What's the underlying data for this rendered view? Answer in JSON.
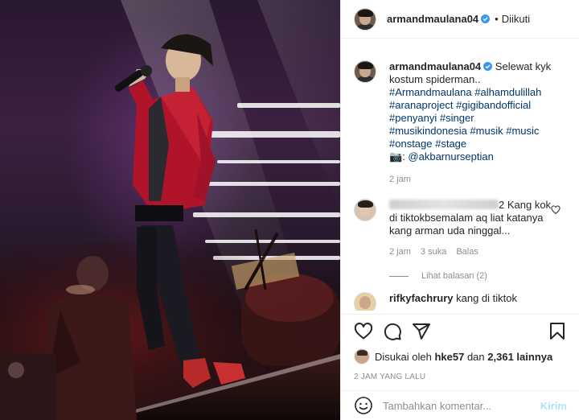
{
  "header": {
    "username": "armandmaulana04",
    "follow_status": "Diikuti"
  },
  "caption": {
    "username": "armandmaulana04",
    "text": "Selewat kyk kostum spiderman..",
    "hashtags": "#Armandmaulana #alhamdulillah #aranaproject #gigibandofficial #penyanyi #singer #musikindonesia #musik #music #onstage #stage",
    "photo_credit_icon": "camera-emoji",
    "photo_credit": "@akbarnurseptian",
    "time": "2 jam"
  },
  "comments": [
    {
      "username_hidden": true,
      "text": "2 Kang kok di tiktokbsemalam aq liat katanya kang arman uda ninggal...",
      "time": "2 jam",
      "likes": "3 suka",
      "reply": "Balas",
      "view_replies": "Lihat balasan (2)"
    },
    {
      "username": "rifkyfachrury",
      "text": "kang di tiktok"
    }
  ],
  "actions": {
    "liked_by_prefix": "Disukai oleh",
    "liked_by_user": "hke57",
    "liked_by_suffix": "dan",
    "liked_by_count": "2,361 lainnya",
    "post_time": "2 JAM YANG LALU"
  },
  "add_comment": {
    "placeholder": "Tambahkan komentar...",
    "post_label": "Kirim"
  },
  "colors": {
    "link": "#00376b",
    "verified": "#3897f0",
    "muted": "#8e8e8e",
    "post_disabled": "#b2dffc"
  }
}
